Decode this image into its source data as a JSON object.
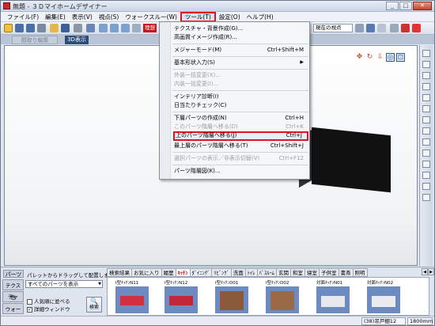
{
  "window": {
    "title": "無題 - ３Ｄマイホームデザイナー",
    "minimize": "_",
    "maximize": "□",
    "close": "✕"
  },
  "menubar": {
    "items": [
      {
        "label": "ファイル(F)"
      },
      {
        "label": "編集(E)"
      },
      {
        "label": "表示(V)"
      },
      {
        "label": "視点(S)"
      },
      {
        "label": "ウォークスルー(W)"
      },
      {
        "label": "ツール(T)"
      },
      {
        "label": "設定(O)"
      },
      {
        "label": "ヘルプ(H)"
      }
    ]
  },
  "toolbar": {
    "red_label": "理想",
    "viewpoint_combo": "現在の視点"
  },
  "modes": {
    "floor_plan": "間取り編集",
    "three_d": "3D表示"
  },
  "tools_menu": {
    "items": [
      {
        "label": "テクスチャ・背景作成(G)...",
        "shortcut": "",
        "disabled": false
      },
      {
        "label": "高画質イメージ作成(R)...",
        "shortcut": "",
        "disabled": false
      },
      {
        "label": "メジャーモード(M)",
        "shortcut": "Ctrl+Shift+M",
        "disabled": false
      },
      {
        "label": "基本形状入力(S)",
        "shortcut": "",
        "disabled": false,
        "submenu": true
      },
      {
        "label": "外装一括変更(X)...",
        "shortcut": "",
        "disabled": true
      },
      {
        "label": "内装一括変更(I)...",
        "shortcut": "",
        "disabled": true
      },
      {
        "label": "インテリア診断(I)",
        "shortcut": "",
        "disabled": false
      },
      {
        "label": "日当たりチェック(C)",
        "shortcut": "",
        "disabled": false
      },
      {
        "label": "下層パーツの作成(N)",
        "shortcut": "Ctrl+H",
        "disabled": false
      },
      {
        "label": "このパーツ階層へ移る(D)",
        "shortcut": "Ctrl+K",
        "disabled": true
      },
      {
        "label": "上のパーツ階層へ移る(J)",
        "shortcut": "Ctrl+J",
        "disabled": false,
        "highlighted": true
      },
      {
        "label": "最上層のパーツ階層へ移る(T)",
        "shortcut": "Ctrl+Shift+J",
        "disabled": false
      },
      {
        "label": "選択パーツの表示／非表示切替(V)",
        "shortcut": "Ctrl+F12",
        "disabled": true
      },
      {
        "label": "パーツ階層図(K)...",
        "shortcut": "",
        "disabled": false
      }
    ]
  },
  "parts_panel": {
    "label": "パーツ",
    "hint": "パレットからドラッグして配置します。",
    "side_tabs": [
      "テクスチャ",
      "色",
      "ウォーク"
    ],
    "filter_select": "すべてのパーツを表示",
    "option_popular": "人気順に並べる",
    "option_detail": "詳細ウィンドウ",
    "search_label": "検索",
    "categories": [
      "検索結果",
      "お気に入り",
      "履歴",
      "ｷｯﾁﾝ",
      "ﾀﾞｲﾆﾝｸﾞ",
      "ﾘﾋﾞﾝｸﾞ",
      "洗面",
      "ﾄｲﾚ",
      "ﾊﾞｽﾙｰﾑ",
      "玄関",
      "和室",
      "寝室",
      "子供室",
      "書斎",
      "照明"
    ],
    "active_category": "ｷｯﾁﾝ",
    "items": [
      {
        "name": "I型ｷｯﾁﾝN11",
        "color": "#d03040"
      },
      {
        "name": "I型ｷｯﾁﾝN12",
        "color": "#c22838"
      },
      {
        "name": "I型ｷｯﾁﾝD01",
        "color": "#8a5a3a"
      },
      {
        "name": "I型ｷｯﾁﾝD02",
        "color": "#9a6a46"
      },
      {
        "name": "対面ｷｯﾁﾝN01",
        "color": "#e8e8ec"
      },
      {
        "name": "対面ｷｯﾁﾝN02",
        "color": "#ececf0"
      }
    ]
  },
  "statusbar": {
    "zoom": "(38)吊戸棚12",
    "size": "1800mm"
  }
}
